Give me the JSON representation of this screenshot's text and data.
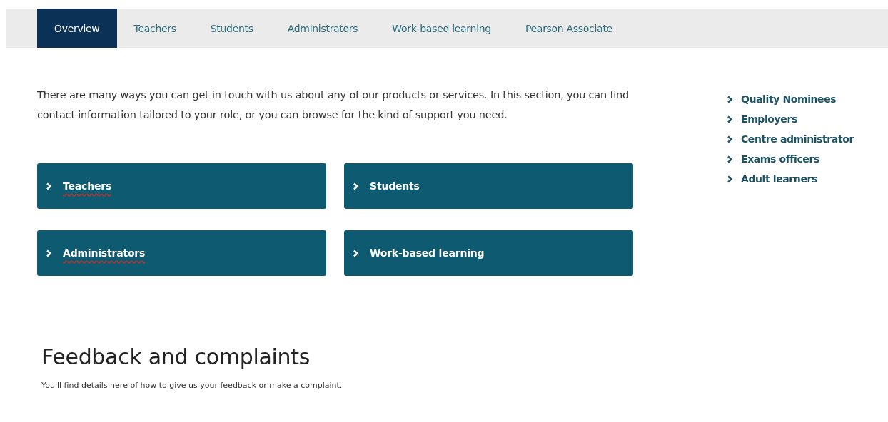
{
  "tabs": [
    {
      "label": "Overview",
      "selected": true
    },
    {
      "label": "Teachers",
      "selected": false
    },
    {
      "label": "Students",
      "selected": false
    },
    {
      "label": "Administrators",
      "selected": false
    },
    {
      "label": "Work-based learning",
      "selected": false
    },
    {
      "label": "Pearson Associate",
      "selected": false
    }
  ],
  "intro": "There are many ways you can get in touch with us about any of our products or services. In this section, you can find contact information tailored to your role, or you can browse for the kind of support you need.",
  "role_buttons": [
    {
      "label": "Teachers",
      "spellcheck_marked": true
    },
    {
      "label": "Students",
      "spellcheck_marked": false
    },
    {
      "label": "Administrators",
      "spellcheck_marked": true
    },
    {
      "label": "Work-based learning",
      "spellcheck_marked": false
    }
  ],
  "sidebar_links": [
    "Quality Nominees",
    "Employers",
    "Centre administrator",
    "Exams officers",
    "Adult learners"
  ],
  "feedback": {
    "heading": "Feedback and complaints",
    "text": "You'll find details here of how to give us your feedback or make a complaint."
  }
}
